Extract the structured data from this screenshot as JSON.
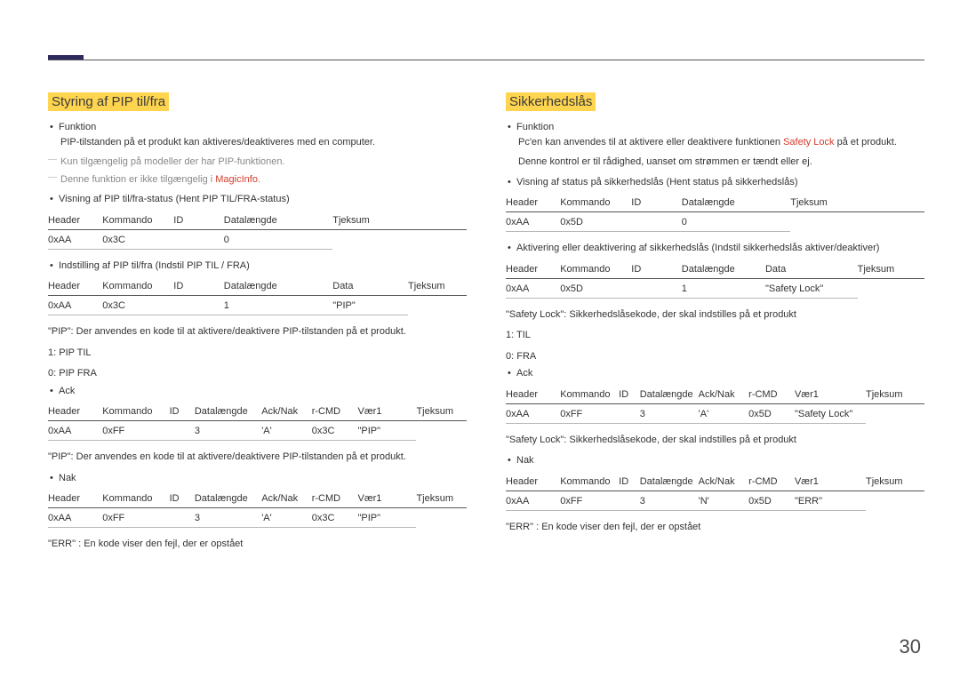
{
  "page_number": "30",
  "left": {
    "heading": "Styring af PIP til/fra",
    "funktion_label": "Funktion",
    "funktion_desc": "PIP-tilstanden på et produkt kan aktiveres/deaktiveres med en computer.",
    "note1": "Kun tilgængelig på modeller der har PIP-funktionen.",
    "note2_pre": "Denne funktion er ikke tilgængelig i ",
    "note2_red": "MagicInfo",
    "note2_post": ".",
    "bullet_view": "Visning af PIP til/fra-status (Hent PIP TIL/FRA-status)",
    "table1": {
      "headers": [
        "Header",
        "Kommando",
        "ID",
        "Datalængde",
        "Tjeksum"
      ],
      "row": [
        "0xAA",
        "0x3C",
        "",
        "0",
        ""
      ]
    },
    "bullet_set": "Indstilling af PIP til/fra (Indstil PIP TIL / FRA)",
    "table2": {
      "headers": [
        "Header",
        "Kommando",
        "ID",
        "Datalængde",
        "Data",
        "Tjeksum"
      ],
      "row": [
        "0xAA",
        "0x3C",
        "",
        "1",
        "\"PIP\"",
        ""
      ]
    },
    "pip_desc": "\"PIP\": Der anvendes en kode til at aktivere/deaktivere PIP-tilstanden på et produkt.",
    "pip_til": "1: PIP TIL",
    "pip_fra": "0: PIP FRA",
    "bullet_ack": "Ack",
    "table3": {
      "headers": [
        "Header",
        "Kommando",
        "ID",
        "Datalængde",
        "Ack/Nak",
        "r-CMD",
        "Vær1",
        "Tjeksum"
      ],
      "row": [
        "0xAA",
        "0xFF",
        "",
        "3",
        "'A'",
        "0x3C",
        "\"PIP\"",
        ""
      ]
    },
    "pip_desc2": "\"PIP\": Der anvendes en kode til at aktivere/deaktivere PIP-tilstanden på et produkt.",
    "bullet_nak": "Nak",
    "table4": {
      "headers": [
        "Header",
        "Kommando",
        "ID",
        "Datalængde",
        "Ack/Nak",
        "r-CMD",
        "Vær1",
        "Tjeksum"
      ],
      "row": [
        "0xAA",
        "0xFF",
        "",
        "3",
        "'A'",
        "0x3C",
        "\"PIP\"",
        ""
      ]
    },
    "err_desc": "\"ERR\" : En kode viser den fejl, der er opstået"
  },
  "right": {
    "heading": "Sikkerhedslås",
    "funktion_label": "Funktion",
    "funktion_desc_pre": "Pc'en kan anvendes til at aktivere eller deaktivere funktionen ",
    "funktion_desc_red": "Safety Lock",
    "funktion_desc_post": " på et produkt.",
    "funktion_desc2": "Denne kontrol er til rådighed, uanset om strømmen er tændt eller ej.",
    "bullet_view": "Visning af status på sikkerhedslås (Hent status på sikkerhedslås)",
    "table1": {
      "headers": [
        "Header",
        "Kommando",
        "ID",
        "Datalængde",
        "Tjeksum"
      ],
      "row": [
        "0xAA",
        "0x5D",
        "",
        "0",
        ""
      ]
    },
    "bullet_set": "Aktivering eller deaktivering af sikkerhedslås (Indstil sikkerhedslås aktiver/deaktiver)",
    "table2": {
      "headers": [
        "Header",
        "Kommando",
        "ID",
        "Datalængde",
        "Data",
        "Tjeksum"
      ],
      "row": [
        "0xAA",
        "0x5D",
        "",
        "1",
        "\"Safety Lock\"",
        ""
      ]
    },
    "safety_desc": "\"Safety Lock\": Sikkerhedslåsekode, der skal indstilles på et produkt",
    "til": "1: TIL",
    "fra": "0: FRA",
    "bullet_ack": "Ack",
    "table3": {
      "headers": [
        "Header",
        "Kommando",
        "ID",
        "Datalængde",
        "Ack/Nak",
        "r-CMD",
        "Vær1",
        "Tjeksum"
      ],
      "row": [
        "0xAA",
        "0xFF",
        "",
        "3",
        "'A'",
        "0x5D",
        "\"Safety Lock\"",
        ""
      ]
    },
    "safety_desc2": "\"Safety Lock\": Sikkerhedslåsekode, der skal indstilles på et produkt",
    "bullet_nak": "Nak",
    "table4": {
      "headers": [
        "Header",
        "Kommando",
        "ID",
        "Datalængde",
        "Ack/Nak",
        "r-CMD",
        "Vær1",
        "Tjeksum"
      ],
      "row": [
        "0xAA",
        "0xFF",
        "",
        "3",
        "'N'",
        "0x5D",
        "\"ERR\"",
        ""
      ]
    },
    "err_desc": "\"ERR\" : En kode viser den fejl, der er opstået"
  }
}
